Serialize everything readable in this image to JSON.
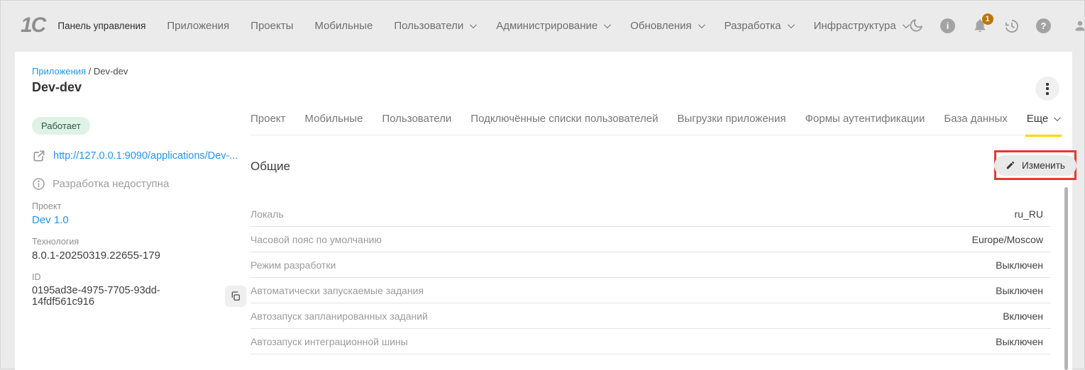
{
  "navbar": {
    "logo": "1С",
    "brand": "Панель управления",
    "items": [
      {
        "label": "Приложения"
      },
      {
        "label": "Проекты"
      },
      {
        "label": "Мобильные"
      },
      {
        "label": "Пользователи"
      },
      {
        "label": "Администрирование"
      },
      {
        "label": "Обновления"
      },
      {
        "label": "Разработка"
      },
      {
        "label": "Инфраструктура"
      }
    ],
    "notification_count": "1",
    "info_glyph": "i",
    "help_glyph": "?"
  },
  "breadcrumb": {
    "parent": "Приложения",
    "separator": " / ",
    "current": "Dev-dev"
  },
  "page": {
    "title": "Dev-dev"
  },
  "sidebar": {
    "status": "Работает",
    "app_url": "http://127.0.0.1:9090/applications/Dev-...",
    "dev_unavailable": "Разработка недоступна",
    "project_label": "Проект",
    "project_value": "Dev 1.0",
    "tech_label": "Технология",
    "tech_value": "8.0.1-20250319.22655-179",
    "id_label": "ID",
    "id_value": "0195ad3e-4975-7705-93dd-14fdf561c916"
  },
  "tabs": [
    {
      "label": "Проект",
      "active": false
    },
    {
      "label": "Мобильные",
      "active": false
    },
    {
      "label": "Пользователи",
      "active": false
    },
    {
      "label": "Подключённые списки пользователей",
      "active": false
    },
    {
      "label": "Выгрузки приложения",
      "active": false
    },
    {
      "label": "Формы аутентификации",
      "active": false
    },
    {
      "label": "База данных",
      "active": false
    },
    {
      "label": "Еще",
      "active": true
    }
  ],
  "section": {
    "title": "Общие",
    "edit_button": "Изменить"
  },
  "settings_rows": [
    {
      "label": "Локаль",
      "value": "ru_RU"
    },
    {
      "label": "Часовой пояс по умолчанию",
      "value": "Europe/Moscow"
    },
    {
      "label": "Режим разработки",
      "value": "Выключен"
    },
    {
      "label": "Автоматически запускаемые задания",
      "value": "Выключен"
    },
    {
      "label": "Автозапуск запланированных заданий",
      "value": "Включен"
    },
    {
      "label": "Автозапуск интеграционной шины",
      "value": "Выключен"
    }
  ],
  "colors": {
    "accent_yellow": "#ffd600",
    "status_badge_bg": "#def3e6",
    "status_badge_text": "#33523f",
    "link_blue": "#2196f3",
    "annotation_red": "#e43a30",
    "notification_badge": "#bd7504"
  }
}
